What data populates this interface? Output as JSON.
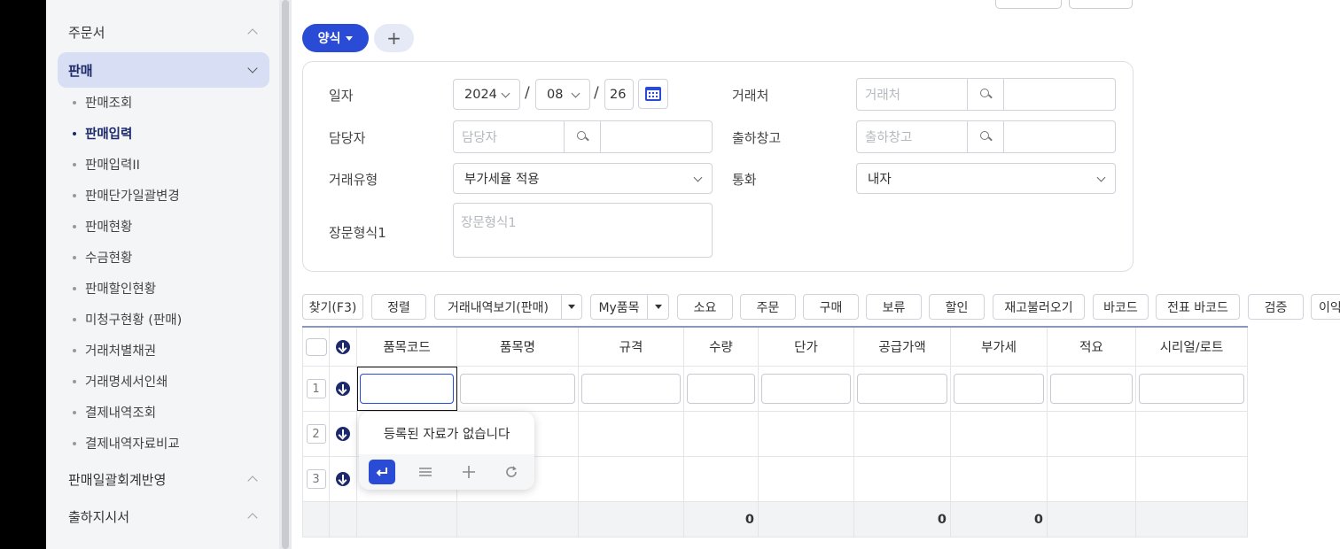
{
  "sidebar": {
    "group_order": "주문서",
    "group_sales": "판매",
    "items": [
      "판매조회",
      "판매입력",
      "판매입력II",
      "판매단가일괄변경",
      "판매현황",
      "수금현황",
      "판매할인현황",
      "미청구현황 (판매)",
      "거래처별채권",
      "거래명세서인쇄",
      "결제내역조회",
      "결제내역자료비교"
    ],
    "active_item": "판매입력",
    "group_batch": "판매일괄회계반영",
    "group_shipping": "출하지시서"
  },
  "header": {
    "template_button": "양식",
    "add_button": "+"
  },
  "form": {
    "date_label": "일자",
    "year": "2024",
    "month": "08",
    "day": "26",
    "date_sep": "/",
    "customer_label": "거래처",
    "customer_placeholder": "거래처",
    "manager_label": "담당자",
    "manager_placeholder": "담당자",
    "warehouse_label": "출하창고",
    "warehouse_placeholder": "출하창고",
    "trade_type_label": "거래유형",
    "trade_type_value": "부가세율 적용",
    "currency_label": "통화",
    "currency_value": "내자",
    "longtext_label": "장문형식1",
    "longtext_placeholder": "장문형식1"
  },
  "toolbar": {
    "find": "찾기(F3)",
    "sort": "정렬",
    "history": "거래내역보기(판매)",
    "my_items": "My품목",
    "consume": "소요",
    "order": "주문",
    "purchase": "구매",
    "hold": "보류",
    "discount": "할인",
    "load_stock": "재고불러오기",
    "barcode": "바코드",
    "slip_barcode": "전표 바코드",
    "verify": "검증",
    "more": "이익"
  },
  "grid": {
    "columns": [
      "품목코드",
      "품목명",
      "규격",
      "수량",
      "단가",
      "공급가액",
      "부가세",
      "적요",
      "시리얼/로트"
    ],
    "row_numbers": [
      "1",
      "2",
      "3"
    ],
    "totals": {
      "qty": "0",
      "supply": "0",
      "vat": "0"
    }
  },
  "popup": {
    "message": "등록된 자료가 없습니다",
    "icons": [
      "enter-icon",
      "menu-icon",
      "plus-icon",
      "refresh-icon"
    ]
  },
  "colors": {
    "primary": "#2a4bd6",
    "sidebar_active_bg": "#d8def3",
    "navy": "#1c2a6b"
  }
}
